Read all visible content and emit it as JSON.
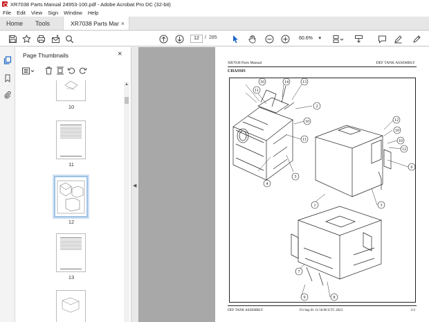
{
  "window": {
    "title": "XR7038 Parts Manual 24953-100.pdf - Adobe Acrobat Pro DC (32-bit)"
  },
  "menu": [
    "File",
    "Edit",
    "View",
    "Sign",
    "Window",
    "Help"
  ],
  "tabs": {
    "home": "Home",
    "tools": "Tools",
    "document": "XR7038 Parts Man...",
    "close": "×"
  },
  "toolbar": {
    "current_page": "12",
    "separator": "/",
    "total_pages": "285",
    "zoom": "60.6%"
  },
  "thumbnail_panel": {
    "title": "Page Thumbnails",
    "close": "×",
    "thumbnails": [
      {
        "label": "10"
      },
      {
        "label": "11"
      },
      {
        "label": "12",
        "selected": true
      },
      {
        "label": "13"
      },
      {
        "label": ""
      }
    ]
  },
  "document_page": {
    "header_left": "XR7038 Parts Manual",
    "header_right": "DEF TANK ASSEMBLY",
    "section": "CHASSIS",
    "footer_left": "DEF TANK ASSEMBLY",
    "footer_center": "Fri Sep 01 11:56:00 UTC 2023",
    "footer_right": "3-2",
    "callouts": [
      "10",
      "14",
      "13",
      "11",
      "2",
      "10",
      "11",
      "4",
      "5",
      "12",
      "10",
      "10",
      "12",
      "6",
      "1",
      "3",
      "7",
      "9",
      "8"
    ]
  },
  "colors": {
    "accent_blue": "#1a66c7",
    "acrobat_red": "#c4161c",
    "doc_background": "#a8a8a8"
  }
}
